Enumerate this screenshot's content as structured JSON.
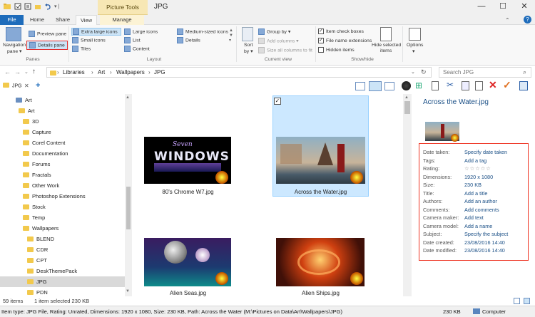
{
  "window": {
    "title": "JPG",
    "contextual_tab": "Picture Tools",
    "min": "—",
    "max": "☐",
    "close": "✕"
  },
  "tabs": [
    "File",
    "Home",
    "Share",
    "View",
    "Manage"
  ],
  "ribbon": {
    "panes": {
      "nav_pane": "Navigation",
      "nav_pane2": "pane ▾",
      "preview": "Preview pane",
      "details": "Details pane",
      "group": "Panes"
    },
    "layout": {
      "xl": "Extra large icons",
      "large": "Large icons",
      "medium": "Medium-sized icons",
      "small": "Small icons",
      "list": "List",
      "details": "Details",
      "tiles": "Tiles",
      "content": "Content",
      "group": "Layout"
    },
    "view": {
      "sort": "Sort",
      "sort2": "by ▾",
      "groupby": "Group by ▾",
      "addcols": "Add columns ▾",
      "sizecols": "Size all columns to fit",
      "group": "Current view"
    },
    "showhide": {
      "itemcheck": "Item check boxes",
      "ext": "File name extensions",
      "hidden": "Hidden items",
      "hidesel": "Hide selected",
      "hidesel2": "items",
      "group": "Show/hide"
    },
    "options": {
      "label": "Options",
      "label2": "▾"
    }
  },
  "address": {
    "path": [
      "Libraries",
      "Art",
      "Wallpapers",
      "JPG"
    ],
    "search_placeholder": "Search JPG"
  },
  "nav": {
    "pinned": "JPG",
    "items": [
      {
        "label": "Art",
        "level": 0
      },
      {
        "label": "Art",
        "level": 1
      },
      {
        "label": "3D",
        "level": 2
      },
      {
        "label": "Capture",
        "level": 2
      },
      {
        "label": "Corel Content",
        "level": 2
      },
      {
        "label": "Documentation",
        "level": 2
      },
      {
        "label": "Forums",
        "level": 2
      },
      {
        "label": "Fractals",
        "level": 2
      },
      {
        "label": "Other Work",
        "level": 2
      },
      {
        "label": "Photoshop Extensions",
        "level": 2
      },
      {
        "label": "Stock",
        "level": 2
      },
      {
        "label": "Temp",
        "level": 2
      },
      {
        "label": "Wallpapers",
        "level": 2
      },
      {
        "label": "BLEND",
        "level": 3
      },
      {
        "label": "CDR",
        "level": 3
      },
      {
        "label": "CPT",
        "level": 3
      },
      {
        "label": "DeskThemePack",
        "level": 3
      },
      {
        "label": "JPG",
        "level": 3
      },
      {
        "label": "PDN",
        "level": 3
      }
    ]
  },
  "files": [
    {
      "name": "80's Chrome W7.jpg",
      "thumb_line1": "Seven",
      "thumb_line2": "WINDOWS"
    },
    {
      "name": "Across the Water.jpg"
    },
    {
      "name": "Alien Seas.jpg"
    },
    {
      "name": "Alien Ships.jpg"
    }
  ],
  "details": {
    "title": "Across the Water.jpg",
    "rows": [
      {
        "k": "Date taken:",
        "v": "Specify date taken"
      },
      {
        "k": "Tags:",
        "v": "Add a tag"
      },
      {
        "k": "Rating:",
        "v": "☆☆☆☆☆"
      },
      {
        "k": "Dimensions:",
        "v": "1920 x 1080"
      },
      {
        "k": "Size:",
        "v": "230 KB"
      },
      {
        "k": "Title:",
        "v": "Add a title"
      },
      {
        "k": "Authors:",
        "v": "Add an author"
      },
      {
        "k": "Comments:",
        "v": "Add comments"
      },
      {
        "k": "Camera maker:",
        "v": "Add text"
      },
      {
        "k": "Camera model:",
        "v": "Add a name"
      },
      {
        "k": "Subject:",
        "v": "Specify the subject"
      },
      {
        "k": "Date created:",
        "v": "23/08/2016 14:40"
      },
      {
        "k": "Date modified:",
        "v": "23/08/2016 14:40"
      }
    ]
  },
  "status": {
    "count": "59 items",
    "selected": "1 item selected  230 KB"
  },
  "bottom": {
    "info": "Item type: JPG File, Rating: Unrated, Dimensions: 1920 x 1080, Size: 230 KB, Path: Across the Water (M:\\Pictures on Data\\Art\\Wallpapers\\JPG)",
    "size": "230 KB",
    "location": "Computer"
  }
}
